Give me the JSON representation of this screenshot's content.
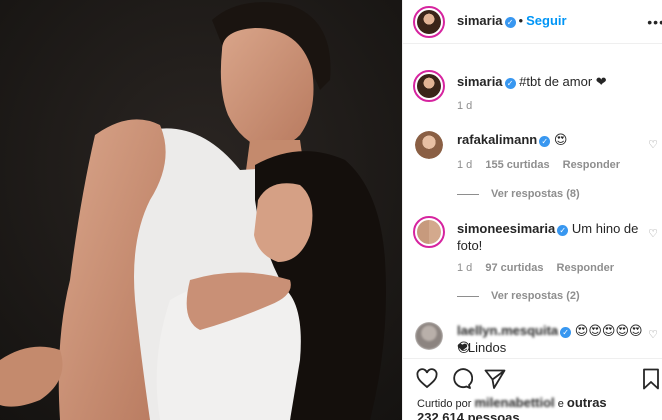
{
  "post": {
    "username": "simaria",
    "follow_label": "Seguir",
    "more_label": "•••",
    "caption_user": "simaria",
    "caption_text": "#tbt de amor ❤",
    "caption_age": "1 d"
  },
  "comments": [
    {
      "user": "rafakalimann",
      "text": "😍",
      "age": "1 d",
      "likes": "155 curtidas",
      "reply": "Responder",
      "view_replies": "Ver respostas (8)"
    },
    {
      "user": "simoneesimaria",
      "text": "Um hino de foto!",
      "age": "1 d",
      "likes": "97 curtidas",
      "reply": "Responder",
      "view_replies": "Ver respostas (2)"
    },
    {
      "user": "laellyn.mesquita",
      "text": "😍😍😍😍😍😍",
      "text2": "❤Lindos"
    }
  ],
  "likes_line": {
    "prefix": "Curtido por",
    "liker": "milenabettiol",
    "conj": "e",
    "rest": "outras 232.614 pessoas"
  },
  "icons": [
    "heart-icon",
    "comment-icon",
    "share-icon",
    "bookmark-icon",
    "verified-icon",
    "heart-outline-icon"
  ],
  "colors": {
    "link": "#0095f6",
    "verified": "#3897f0",
    "muted": "#8e8e8e"
  }
}
